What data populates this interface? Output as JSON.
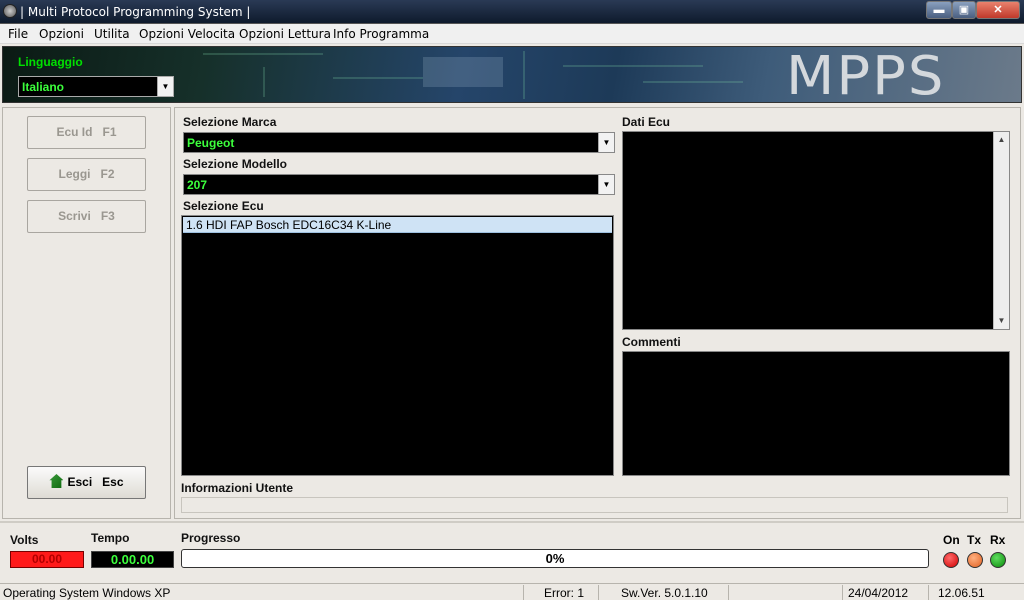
{
  "window": {
    "title": "| Multi Protocol Programming System |",
    "buttons": {
      "minimize": "▬",
      "maximize": "▣",
      "close": "✕"
    }
  },
  "menu": [
    "File",
    "Opzioni",
    "Utilita",
    "Opzioni Velocita",
    "Opzioni Lettura",
    "Info Programma"
  ],
  "banner": {
    "language_label": "Linguaggio",
    "language_value": "Italiano",
    "logo": "MPPS"
  },
  "sidebar": {
    "buttons": [
      {
        "label": "Ecu Id",
        "key": "F1"
      },
      {
        "label": "Leggi",
        "key": "F2"
      },
      {
        "label": "Scrivi",
        "key": "F3"
      }
    ],
    "exit": {
      "label": "Esci",
      "key": "Esc",
      "icon": "home-exit-icon"
    }
  },
  "main": {
    "marca_label": "Selezione Marca",
    "marca_value": "Peugeot",
    "modello_label": "Selezione Modello",
    "modello_value": "207",
    "ecu_label": "Selezione Ecu",
    "ecu_items": [
      "1.6 HDI FAP Bosch EDC16C34 K-Line"
    ],
    "dati_label": "Dati Ecu",
    "commenti_label": "Commenti",
    "info_label": "Informazioni Utente"
  },
  "bottom": {
    "volts_label": "Volts",
    "volts_value": "00.00",
    "tempo_label": "Tempo",
    "tempo_value": "0.00.00",
    "progress_label": "Progresso",
    "progress_text": "0%",
    "progress_fraction": 0,
    "leds": [
      {
        "label": "On",
        "color": "#d10000"
      },
      {
        "label": "Tx",
        "color": "#e06020"
      },
      {
        "label": "Rx",
        "color": "#0a8a0a"
      }
    ]
  },
  "status": {
    "os": "Operating System Windows XP",
    "error": "Error: 1",
    "version": "Sw.Ver. 5.0.1.10",
    "date": "24/04/2012",
    "time": "12.06.51"
  },
  "colors": {
    "accent_green": "#3cff3c",
    "volts_red": "#ff1a1a"
  }
}
